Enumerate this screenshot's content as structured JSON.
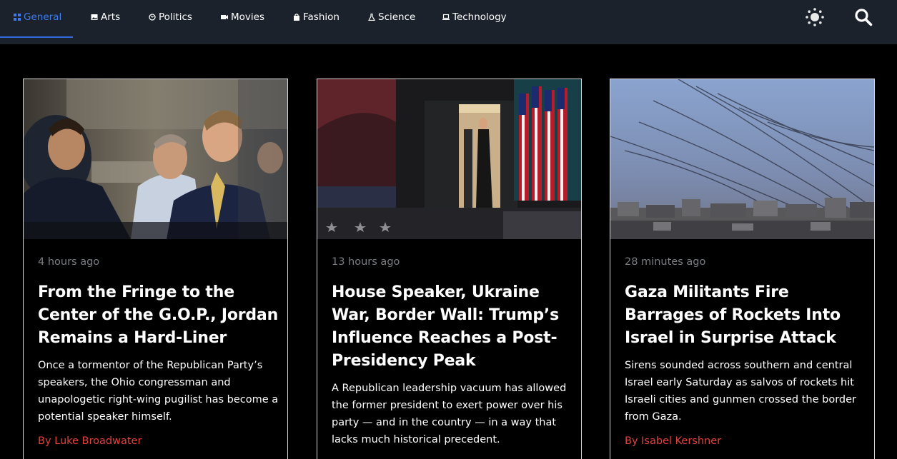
{
  "nav": {
    "items": [
      {
        "label": "General",
        "icon": "grid-icon",
        "active": true
      },
      {
        "label": "Arts",
        "icon": "image-icon",
        "active": false
      },
      {
        "label": "Politics",
        "icon": "globe-icon",
        "active": false
      },
      {
        "label": "Movies",
        "icon": "video-camera-icon",
        "active": false
      },
      {
        "label": "Fashion",
        "icon": "shopping-bag-icon",
        "active": false
      },
      {
        "label": "Science",
        "icon": "flask-icon",
        "active": false
      },
      {
        "label": "Technology",
        "icon": "laptop-icon",
        "active": false
      }
    ],
    "tools": [
      {
        "icon": "sun-theme-toggle-icon"
      },
      {
        "icon": "search-icon"
      }
    ],
    "colors": {
      "background": "#1b222b",
      "active": "#3d7bf0",
      "text": "#ffffff"
    }
  },
  "articles": [
    {
      "time": "4 hours ago",
      "title": "From the Fringe to the Center of the G.O.P., Jordan Remains a Hard-Liner",
      "description": "Once a tormentor of the Republican Party’s speakers, the Ohio congressman and unapologetic right-wing pugilist has become a potential speaker himself.",
      "author": "By Luke Broadwater",
      "image": "photo-of-men-in-suits-at-hearing"
    },
    {
      "time": "13 hours ago",
      "title": "House Speaker, Ukraine War, Border Wall: Trump’s Influence Reaches a Post-Presidency Peak",
      "description": "A Republican leadership vacuum has allowed the former president to exert power over his party — and in the country — in a way that lacks much historical precedent.",
      "author": "",
      "image": "photo-of-man-in-doorway-with-american-flags"
    },
    {
      "time": "28 minutes ago",
      "title": "Gaza Militants Fire Barrages of Rockets Into Israel in Surprise Attack",
      "description": "Sirens sounded across southern and central Israel early Saturday as salvos of rockets hit Israeli cities and gunmen crossed the border from Gaza.",
      "author": "By Isabel Kershner",
      "image": "photo-of-rocket-trails-over-city"
    }
  ],
  "colors": {
    "page_background": "#000000",
    "card_border": "#d6d6d6",
    "author": "#e5403a",
    "timestamp": "#7a7d82"
  }
}
